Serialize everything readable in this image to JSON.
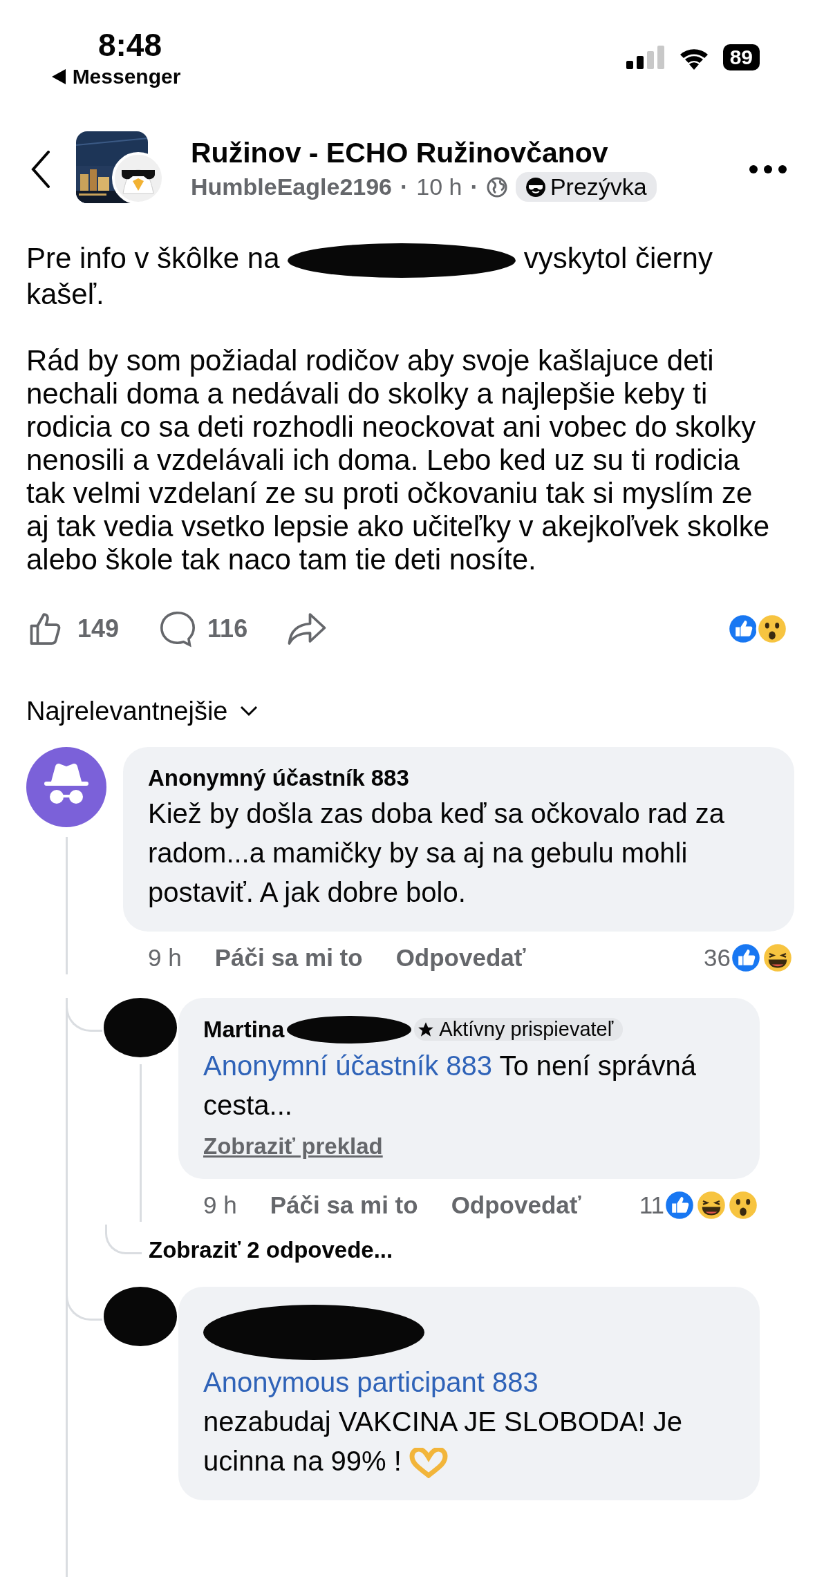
{
  "status_bar": {
    "time": "8:48",
    "back_app": "Messenger",
    "battery": "89"
  },
  "header": {
    "group_name": "Ružinov - ECHO Ružinovčanov",
    "author": "HumbleEagle2196",
    "separator_1": "·",
    "time": "10 h",
    "separator_2": "·",
    "badge": "Prezývka"
  },
  "post": {
    "paragraphs": [
      [
        {
          "kind": "text",
          "text": "Pre info v škôlke na"
        },
        {
          "kind": "redaction"
        },
        {
          "kind": "text",
          "text": "vyskytol čierny"
        },
        {
          "kind": "text",
          "text": "kašeľ."
        }
      ],
      [
        {
          "kind": "text",
          "text": "Rád by som požiadal rodičov aby svoje kašlajuce deti nechali doma a nedávali do skolky a najlepšie keby ti rodicia co sa deti rozhodli neockovat ani vobec do skolky nenosili a vzdelávali ich doma. Lebo ked uz su ti rodicia tak velmi vzdelaní ze su proti očkovaniu tak si myslím ze aj tak vedia vsetko lepsie ako učiteľky v akejkoľvek skolke alebo škole tak naco tam tie deti nosíte."
        }
      ]
    ],
    "likes": "149",
    "comments": "116",
    "reactions": [
      {
        "kind": "like"
      },
      {
        "kind": "wow"
      }
    ]
  },
  "sort": {
    "label": "Najrelevantnejšie"
  },
  "comments": [
    {
      "kind": "anonymous",
      "author": "Anonymný účastník 883",
      "text": "Kiež by došla zas doba keď sa očkovalo rad za radom...a mamičky by sa aj na gebulu mohli postaviť. A jak dobre bolo.",
      "time": "9 h",
      "like": "Páči sa mi to",
      "reply": "Odpovedať",
      "count": "36",
      "reactions": [
        {
          "kind": "like"
        },
        {
          "kind": "haha"
        }
      ],
      "children": [
        {
          "kind": "redacted",
          "author": "Martina",
          "author_redacted": true,
          "badge": "Aktívny prispievateľ",
          "mention": "Anonymní účastník 883",
          "text": "To není správná cesta...",
          "translate": "Zobraziť preklad",
          "time": "9 h",
          "like": "Páči sa mi to",
          "reply": "Odpovedať",
          "count": "11",
          "reactions": [
            {
              "kind": "like"
            },
            {
              "kind": "haha"
            },
            {
              "kind": "wow"
            }
          ],
          "more_replies": "Zobraziť 2 odpovede..."
        },
        {
          "kind": "redacted",
          "author_redacted": true,
          "mention": "Anonymous participant 883",
          "mention_break": true,
          "text": "nezabudaj VAKCINA JE SLOBODA! Je ucinna na 99% !",
          "heart_hands": true
        }
      ]
    }
  ]
}
